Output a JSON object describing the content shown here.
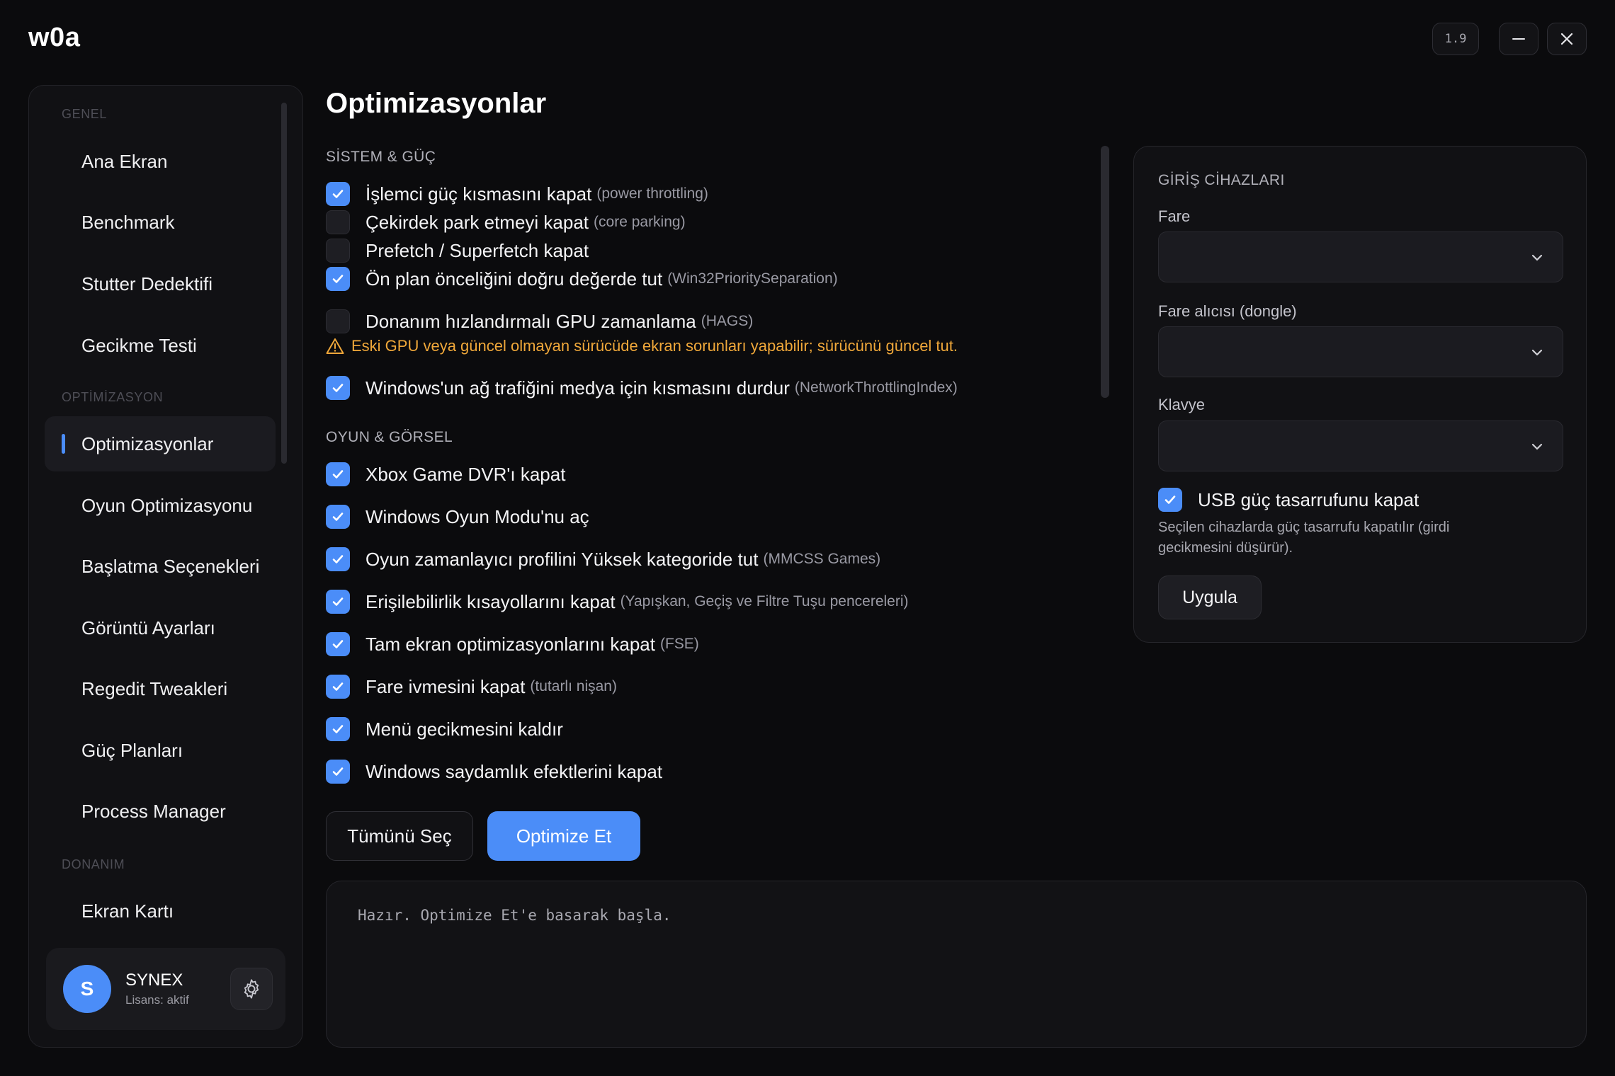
{
  "app": {
    "title": "w0a",
    "version": "1.9"
  },
  "sidebar": {
    "sections": [
      {
        "label": "GENEL"
      },
      {
        "label": "OPTİMİZASYON"
      },
      {
        "label": "DONANIM"
      }
    ],
    "items": [
      {
        "label": "Ana Ekran"
      },
      {
        "label": "Benchmark"
      },
      {
        "label": "Stutter Dedektifi"
      },
      {
        "label": "Gecikme Testi"
      },
      {
        "label": "Optimizasyonlar",
        "active": true
      },
      {
        "label": "Oyun Optimizasyonu"
      },
      {
        "label": "Başlatma Seçenekleri"
      },
      {
        "label": "Görüntü Ayarları"
      },
      {
        "label": "Regedit Tweakleri"
      },
      {
        "label": "Güç Planları"
      },
      {
        "label": "Process Manager"
      },
      {
        "label": "Ekran Kartı"
      }
    ],
    "user": {
      "initial": "S",
      "name": "SYNEX",
      "license": "Lisans: aktif"
    }
  },
  "main": {
    "title": "Optimizasyonlar",
    "system_section": {
      "heading": "SİSTEM & GÜÇ",
      "options": [
        {
          "label": "İşlemci güç kısmasını kapat",
          "hint": "(power throttling)",
          "checked": true
        },
        {
          "label": "Çekirdek park etmeyi kapat",
          "hint": "(core parking)",
          "checked": false
        },
        {
          "label": "Prefetch / Superfetch kapat",
          "hint": "",
          "checked": false
        },
        {
          "label": "Ön plan önceliğini doğru değerde tut",
          "hint": "(Win32PrioritySeparation)",
          "checked": true
        },
        {
          "label": "Donanım hızlandırmalı GPU zamanlama",
          "hint": "(HAGS)",
          "checked": false
        },
        {
          "label": "Windows'un ağ trafiğini medya için kısmasını durdur",
          "hint": "(NetworkThrottlingIndex)",
          "checked": true
        }
      ],
      "warning": "Eski GPU veya güncel olmayan sürücüde ekran sorunları yapabilir; sürücünü güncel tut."
    },
    "game_section": {
      "heading": "OYUN & GÖRSEL",
      "options": [
        {
          "label": "Xbox Game DVR'ı kapat",
          "hint": "",
          "checked": true
        },
        {
          "label": "Windows Oyun Modu'nu aç",
          "hint": "",
          "checked": true
        },
        {
          "label": "Oyun zamanlayıcı profilini Yüksek kategoride tut",
          "hint": "(MMCSS Games)",
          "checked": true
        },
        {
          "label": "Erişilebilirlik kısayollarını kapat",
          "hint": "(Yapışkan, Geçiş ve Filtre Tuşu pencereleri)",
          "checked": true
        },
        {
          "label": "Tam ekran optimizasyonlarını kapat",
          "hint": "(FSE)",
          "checked": true
        },
        {
          "label": "Fare ivmesini kapat",
          "hint": "(tutarlı nişan)",
          "checked": true
        },
        {
          "label": "Menü gecikmesini kaldır",
          "hint": "",
          "checked": true
        },
        {
          "label": "Windows saydamlık efektlerini kapat",
          "hint": "",
          "checked": true
        }
      ]
    },
    "buttons": {
      "select_all": "Tümünü Seç",
      "optimize": "Optimize Et"
    },
    "log": "Hazır. Optimize Et'e basarak başla."
  },
  "devices": {
    "heading": "GİRİŞ CİHAZLARI",
    "mouse_label": "Fare",
    "mouse_value": "",
    "dongle_label": "Fare alıcısı (dongle)",
    "dongle_value": "",
    "keyboard_label": "Klavye",
    "keyboard_value": "",
    "usb_label": "USB güç tasarrufunu kapat",
    "usb_checked": true,
    "usb_desc": "Seçilen cihazlarda güç tasarrufu kapatılır (girdi gecikmesini düşürür).",
    "apply": "Uygula"
  },
  "colors": {
    "accent": "#4b8df8",
    "warning": "#f0a83a",
    "background": "#0b0b0d",
    "panel": "#111114"
  }
}
